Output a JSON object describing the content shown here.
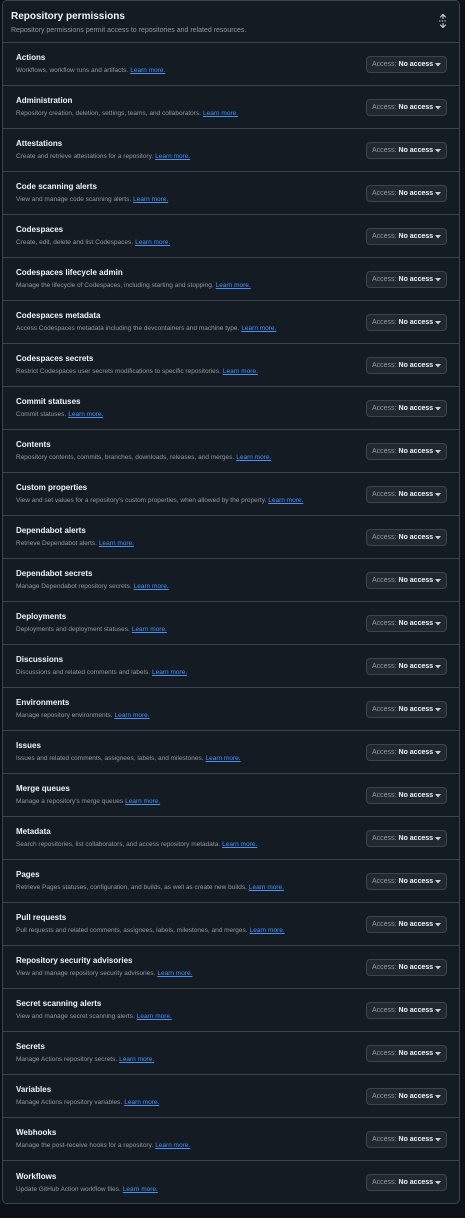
{
  "header": {
    "title": "Repository permissions",
    "subtitle": "Repository permissions permit access to repositories and related resources.",
    "collapse_icon": "unfold-icon"
  },
  "access_prefix": "Access:",
  "learn_more_label": "Learn more.",
  "colors": {
    "link": "#4493f8",
    "panel_bg": "#151b23",
    "border": "#3d444d",
    "text": "#f0f6fc",
    "muted": "#9198a1"
  },
  "permissions": [
    {
      "name": "Actions",
      "desc": "Workflows, workflow runs and artifacts.",
      "access": "No access"
    },
    {
      "name": "Administration",
      "desc": "Repository creation, deletion, settings, teams, and collaborators.",
      "access": "No access"
    },
    {
      "name": "Attestations",
      "desc": "Create and retrieve attestations for a repository.",
      "access": "No access"
    },
    {
      "name": "Code scanning alerts",
      "desc": "View and manage code scanning alerts.",
      "access": "No access"
    },
    {
      "name": "Codespaces",
      "desc": "Create, edit, delete and list Codespaces.",
      "access": "No access"
    },
    {
      "name": "Codespaces lifecycle admin",
      "desc": "Manage the lifecycle of Codespaces, including starting and stopping.",
      "access": "No access"
    },
    {
      "name": "Codespaces metadata",
      "desc": "Access Codespaces metadata including the devcontainers and machine type.",
      "access": "No access"
    },
    {
      "name": "Codespaces secrets",
      "desc": "Restrict Codespaces user secrets modifications to specific repositories.",
      "access": "No access"
    },
    {
      "name": "Commit statuses",
      "desc": "Commit statuses.",
      "access": "No access"
    },
    {
      "name": "Contents",
      "desc": "Repository contents, commits, branches, downloads, releases, and merges.",
      "access": "No access"
    },
    {
      "name": "Custom properties",
      "desc": "View and set values for a repository's custom properties, when allowed by the property.",
      "access": "No access"
    },
    {
      "name": "Dependabot alerts",
      "desc": "Retrieve Dependabot alerts.",
      "access": "No access"
    },
    {
      "name": "Dependabot secrets",
      "desc": "Manage Dependabot repository secrets.",
      "access": "No access"
    },
    {
      "name": "Deployments",
      "desc": "Deployments and deployment statuses.",
      "access": "No access"
    },
    {
      "name": "Discussions",
      "desc": "Discussions and related comments and labels.",
      "access": "No access"
    },
    {
      "name": "Environments",
      "desc": "Manage repository environments.",
      "access": "No access"
    },
    {
      "name": "Issues",
      "desc": "Issues and related comments, assignees, labels, and milestones.",
      "access": "No access"
    },
    {
      "name": "Merge queues",
      "desc": "Manage a repository's merge queues",
      "access": "No access"
    },
    {
      "name": "Metadata",
      "desc": "Search repositories, list collaborators, and access repository metadata.",
      "access": "No access"
    },
    {
      "name": "Pages",
      "desc": "Retrieve Pages statuses, configuration, and builds, as well as create new builds.",
      "access": "No access"
    },
    {
      "name": "Pull requests",
      "desc": "Pull requests and related comments, assignees, labels, milestones, and merges.",
      "access": "No access"
    },
    {
      "name": "Repository security advisories",
      "desc": "View and manage repository security advisories.",
      "access": "No access"
    },
    {
      "name": "Secret scanning alerts",
      "desc": "View and manage secret scanning alerts.",
      "access": "No access"
    },
    {
      "name": "Secrets",
      "desc": "Manage Actions repository secrets.",
      "access": "No access"
    },
    {
      "name": "Variables",
      "desc": "Manage Actions repository variables.",
      "access": "No access"
    },
    {
      "name": "Webhooks",
      "desc": "Manage the post-receive hooks for a repository.",
      "access": "No access"
    },
    {
      "name": "Workflows",
      "desc": "Update GitHub Action workflow files.",
      "access": "No access"
    }
  ]
}
